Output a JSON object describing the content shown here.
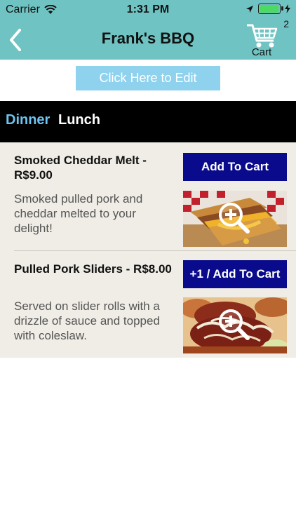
{
  "status_bar": {
    "carrier": "Carrier",
    "time": "1:31 PM"
  },
  "nav": {
    "title": "Frank's BBQ",
    "cart_count": "2",
    "cart_label": "Cart",
    "back_icon": "chevron-left-icon",
    "cart_icon": "cart-icon"
  },
  "edit": {
    "label": "Click Here to Edit"
  },
  "tabs": [
    {
      "label": "Dinner",
      "active": true
    },
    {
      "label": "Lunch",
      "active": false
    }
  ],
  "menu_items": [
    {
      "title": "Smoked Cheddar Melt - R$9.00",
      "button": "Add To Cart",
      "description": "Smoked pulled pork and cheddar melted to your delight!",
      "photo_icon": "zoom-in-icon"
    },
    {
      "title": "Pulled Pork Sliders - R$8.00",
      "button": "+1 / Add To Cart",
      "description": "Served on slider rolls with a drizzle of sauce and topped with coleslaw.",
      "photo_icon": "zoom-in-icon"
    }
  ],
  "colors": {
    "header": "#6fc3c2",
    "tab_active": "#6fc3ee",
    "button": "#0a0a8c",
    "edit_button": "#8fd2ee",
    "list_bg": "#f0ede6"
  }
}
